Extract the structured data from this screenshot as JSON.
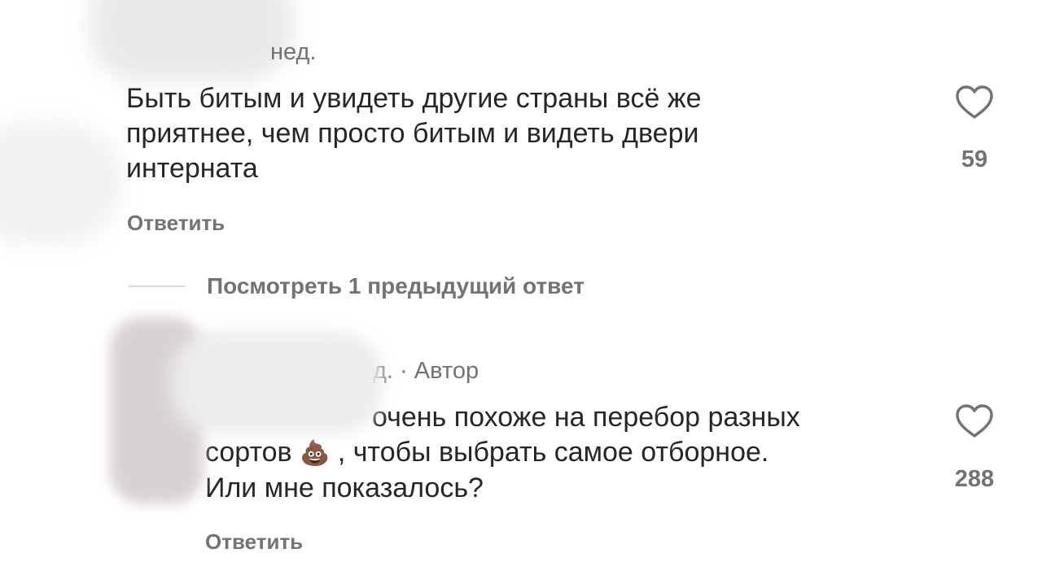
{
  "comments": [
    {
      "meta": "нед.",
      "text_lines": [
        "Быть битым и увидеть другие страны всё же",
        "приятнее, чем просто битым и  видеть двери",
        "интерната"
      ],
      "reply_label": "Ответить",
      "likes": "59",
      "like_icon": "heart-outline-icon"
    },
    {
      "meta": "д. · Автор",
      "text_lines": [
        "очень похоже на перебор разных",
        "сортов",
        ", чтобы выбрать самое отборное.",
        "Или мне показалось?"
      ],
      "emoji": "💩",
      "reply_label": "Ответить",
      "likes": "288",
      "like_icon": "heart-outline-icon"
    }
  ],
  "view_replies_label": "Посмотреть 1 предыдущий ответ",
  "colors": {
    "text": "#262626",
    "secondary": "#737373",
    "divider": "#dbdbdb",
    "background": "#ffffff"
  }
}
